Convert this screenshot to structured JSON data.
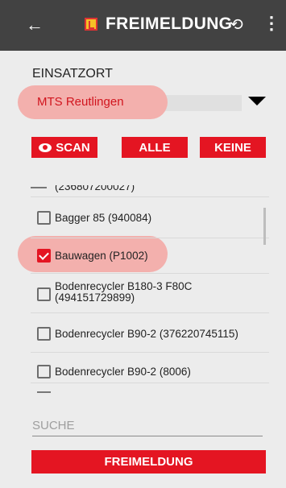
{
  "header": {
    "back_icon": "arrow-left-icon",
    "title": "FREIMELDUNG",
    "sync_icon": "sync-icon",
    "menu_icon": "more-vert-icon",
    "bg_color": "#424242"
  },
  "einsatzort": {
    "label": "EINSATZORT",
    "selected": "MTS Reutlingen"
  },
  "buttons": {
    "scan": "SCAN",
    "alle": "ALLE",
    "keine": "KEINE",
    "accent": "#e41522"
  },
  "list": {
    "items": [
      {
        "label": "(236807200027)",
        "checked": false
      },
      {
        "label": "Bagger 85 (940084)",
        "checked": false
      },
      {
        "label": "Bauwagen (P1002)",
        "checked": true
      },
      {
        "label": "Bodenrecycler B180-3 F80C (494151729899)",
        "checked": false
      },
      {
        "label": "Bodenrecycler B90-2 (376220745115)",
        "checked": false
      },
      {
        "label": "Bodenrecycler B90-2 (8006)",
        "checked": false
      }
    ]
  },
  "search": {
    "placeholder": "SUCHE"
  },
  "footer": {
    "submit": "FREIMELDUNG"
  }
}
